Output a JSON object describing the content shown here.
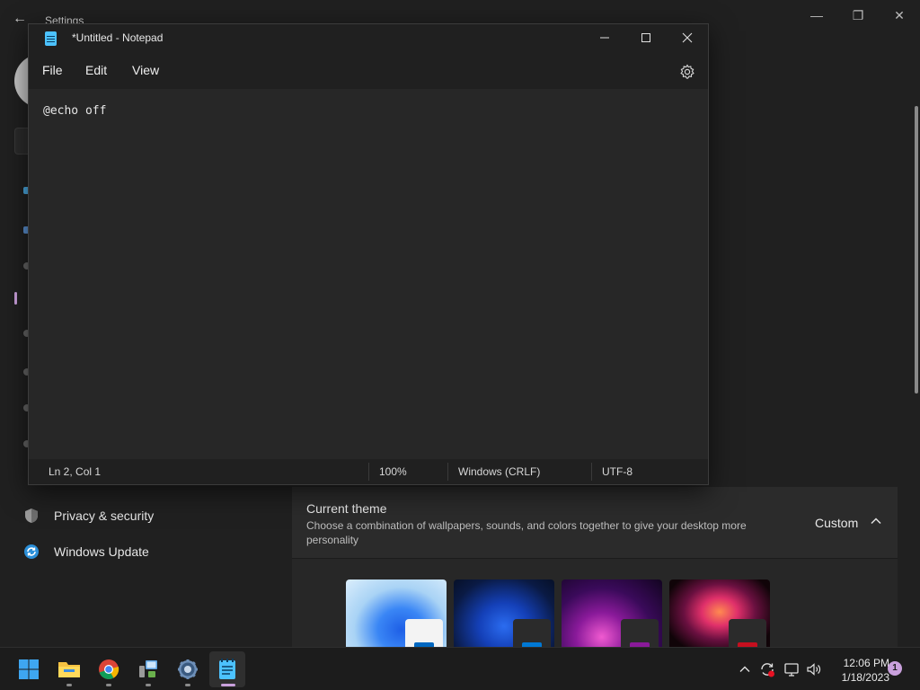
{
  "settings": {
    "title": "Settings",
    "nav_items": [
      {
        "label": "Privacy & security",
        "icon": "shield-icon"
      },
      {
        "label": "Windows Update",
        "icon": "windows-update-icon"
      }
    ],
    "current_theme": {
      "title": "Current theme",
      "description": "Choose a combination of wallpapers, sounds, and colors together to give your desktop more personality",
      "value": "Custom"
    },
    "themes": [
      {
        "name": "windows-light-theme",
        "accent": "#0067c0"
      },
      {
        "name": "windows-dark-theme",
        "accent": "#0078d4"
      },
      {
        "name": "glow-theme",
        "accent": "#8a1a9a"
      },
      {
        "name": "captured-motion-theme",
        "accent": "#c50f1f"
      }
    ]
  },
  "notepad": {
    "title": "*Untitled - Notepad",
    "menu": [
      "File",
      "Edit",
      "View"
    ],
    "content": "@echo off",
    "status": {
      "position": "Ln 2, Col 1",
      "zoom": "100%",
      "line_ending": "Windows (CRLF)",
      "encoding": "UTF-8"
    }
  },
  "taskbar": {
    "apps": [
      {
        "name": "start-button"
      },
      {
        "name": "file-explorer"
      },
      {
        "name": "chrome"
      },
      {
        "name": "remote-app"
      },
      {
        "name": "settings-app"
      },
      {
        "name": "notepad-app",
        "active": true
      }
    ],
    "clock": {
      "time": "12:06 PM",
      "date": "1/18/2023"
    },
    "notification_count": "1"
  },
  "colors": {
    "accent": "#c9a0dc",
    "notepad_icon": "#4cc2ff"
  }
}
